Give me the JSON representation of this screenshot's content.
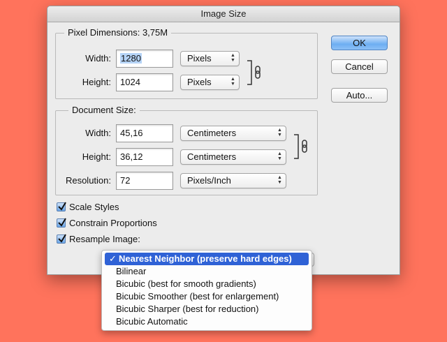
{
  "window": {
    "title": "Image Size"
  },
  "pixel_dimensions": {
    "legend": "Pixel Dimensions:",
    "size": "3,75M",
    "width_label": "Width:",
    "width_value": "1280",
    "width_unit": "Pixels",
    "height_label": "Height:",
    "height_value": "1024",
    "height_unit": "Pixels"
  },
  "document_size": {
    "legend": "Document Size:",
    "width_label": "Width:",
    "width_value": "45,16",
    "width_unit": "Centimeters",
    "height_label": "Height:",
    "height_value": "36,12",
    "height_unit": "Centimeters",
    "resolution_label": "Resolution:",
    "resolution_value": "72",
    "resolution_unit": "Pixels/Inch"
  },
  "buttons": {
    "ok": "OK",
    "cancel": "Cancel",
    "auto": "Auto..."
  },
  "options": {
    "scale_styles": {
      "label": "Scale Styles",
      "checked": true
    },
    "constrain_proportions": {
      "label": "Constrain Proportions",
      "checked": true
    },
    "resample_image": {
      "label": "Resample Image:",
      "checked": true
    }
  },
  "resample_menu": {
    "selected_index": 0,
    "check": "✓",
    "items": [
      "Nearest Neighbor (preserve hard edges)",
      "Bilinear",
      "Bicubic (best for smooth gradients)",
      "Bicubic Smoother (best for enlargement)",
      "Bicubic Sharper (best for reduction)",
      "Bicubic Automatic"
    ]
  },
  "icons": {
    "link": "chain-link-icon",
    "popup_arrows": "up-down-arrows-icon",
    "checkbox": "checkmark-icon"
  },
  "colors": {
    "background": "#ff735c",
    "default_button": "#6daef2",
    "menu_highlight": "#2f62d6",
    "text_selection": "#b5d3f6"
  }
}
